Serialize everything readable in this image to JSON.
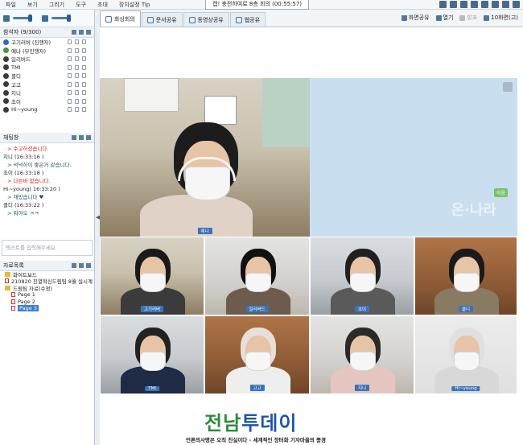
{
  "menu": [
    "파일",
    "보기",
    "그리기",
    "도구",
    "초대",
    "장치설정 Tip"
  ],
  "meeting_title": "캡! 충전하여로 8층 회의 (00:55:57)",
  "participants_panel": {
    "header": "참석자 (9/300)",
    "items": [
      {
        "name": "고기러버 (진행자)",
        "icon_color": "#2a6eb5"
      },
      {
        "name": "예나 (부진행자)",
        "icon_color": "#3a9a3a"
      },
      {
        "name": "일리버드",
        "icon_color": "#3a3a3a"
      },
      {
        "name": "TMI",
        "icon_color": "#3a3a3a"
      },
      {
        "name": "클디",
        "icon_color": "#3a3a3a"
      },
      {
        "name": "고고",
        "icon_color": "#3a3a3a"
      },
      {
        "name": "지니",
        "icon_color": "#3a3a3a"
      },
      {
        "name": "초이",
        "icon_color": "#3a3a3a"
      },
      {
        "name": "Hi~young",
        "icon_color": "#3a3a3a"
      }
    ]
  },
  "chat_panel": {
    "header": "채팅창",
    "lines": [
      {
        "type": "msg",
        "text": "> 수고하셨습니다."
      },
      {
        "type": "name",
        "text": "지니 (16:33:16 )"
      },
      {
        "type": "msg-blue",
        "text": "> 넉넉하이 좋은거 같습니다."
      },
      {
        "type": "name",
        "text": "초이 (16:33:18 )"
      },
      {
        "type": "msg",
        "text": "> 다른바 없습니다."
      },
      {
        "type": "name",
        "text": "Hi~young( 16:33:20 )"
      },
      {
        "type": "msg-blue",
        "text": "> 재밌습니다 ♥"
      },
      {
        "type": "name",
        "text": "클디 (16:33:22 )"
      },
      {
        "type": "msg-blue",
        "text": "> 뭐야오 ㅋㅋ"
      }
    ],
    "input_placeholder": "텍스트를 입력해주세요"
  },
  "resources_panel": {
    "header": "자료목록",
    "items": [
      {
        "label": "화이트보드",
        "level": 0,
        "kind": "folder"
      },
      {
        "label": "210820 진열혁신드림팀 8월 실시계",
        "level": 0,
        "kind": "page"
      },
      {
        "label": "드림팀 자료(수정)",
        "level": 0,
        "kind": "folder"
      },
      {
        "label": "Page 1",
        "level": 1,
        "kind": "page"
      },
      {
        "label": "Page 2",
        "level": 1,
        "kind": "page"
      },
      {
        "label": "Page 3",
        "level": 1,
        "kind": "page",
        "selected": true
      }
    ]
  },
  "tabs": [
    {
      "label": "화상회의",
      "active": true
    },
    {
      "label": "문서공유",
      "active": false
    },
    {
      "label": "동영상공유",
      "active": false
    },
    {
      "label": "웹공유",
      "active": false
    }
  ],
  "toolbar": {
    "screen_share": "화면공유",
    "open": "열기",
    "speak": "발표",
    "layout": "10화면(고)"
  },
  "video_tiles": {
    "main": "예나",
    "tiles": [
      "고기러버",
      "일리버드",
      "초이",
      "클디",
      "TMI",
      "고고",
      "지니",
      "Hi~young"
    ]
  },
  "onnara": {
    "logo": "온·나라",
    "badge": "이음"
  },
  "brand": {
    "title_green": "전남",
    "title_blue": "투데이",
    "subtitle": "언론의사명은 오직 진실이다 - 세계적인 장터화 기자마을의 풍경"
  }
}
